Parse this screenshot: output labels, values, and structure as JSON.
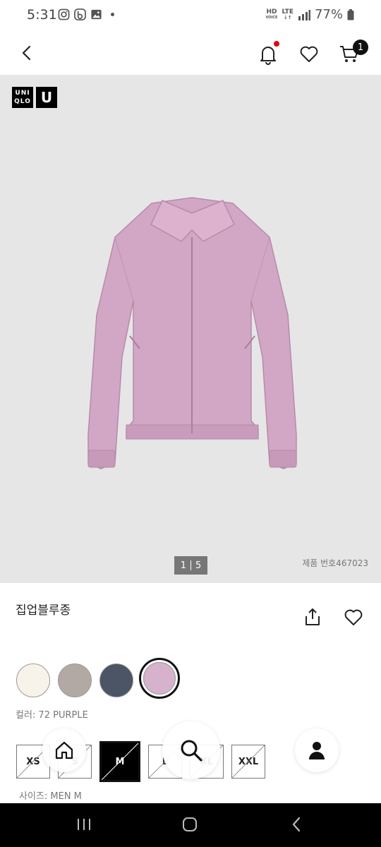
{
  "status_bar": {
    "time": "5:31",
    "network_top": "HD",
    "network_sub": "VOICE",
    "lte": "LTE",
    "battery": "77%"
  },
  "header": {
    "cart_count": "1",
    "icons": [
      "back-icon",
      "bell-icon",
      "heart-icon",
      "cart-icon"
    ],
    "notification_color": "#e60012"
  },
  "hero": {
    "brand_logo_line1": "UNI",
    "brand_logo_line2": "QLO",
    "brand_u": "U",
    "pager_current": "1",
    "pager_total": "5",
    "product_code": "제품 번호467023",
    "background": "#e6e6e6",
    "garment_color": "#d4a8c7"
  },
  "product": {
    "name": "집업블루종",
    "colors": [
      {
        "name": "off-white",
        "hex": "#f8f3ea",
        "selected": false
      },
      {
        "name": "beige-gray",
        "hex": "#b3a9a4",
        "selected": false
      },
      {
        "name": "navy-gray",
        "hex": "#4c5565",
        "selected": false
      },
      {
        "name": "purple",
        "hex": "#d7b2cc",
        "selected": true
      }
    ],
    "color_label": "컬러: 72 PURPLE",
    "sizes": [
      {
        "label": "XS",
        "available": false,
        "selected": false
      },
      {
        "label": "S",
        "available": false,
        "selected": false
      },
      {
        "label": "M",
        "available": true,
        "selected": true
      },
      {
        "label": "L",
        "available": false,
        "selected": false
      },
      {
        "label": "XL",
        "available": false,
        "selected": false
      },
      {
        "label": "XXL",
        "available": false,
        "selected": false
      }
    ],
    "size_label": "사이즈: MEN M"
  },
  "floating": {
    "icons": [
      "home-icon",
      "search-icon",
      "user-icon"
    ]
  }
}
